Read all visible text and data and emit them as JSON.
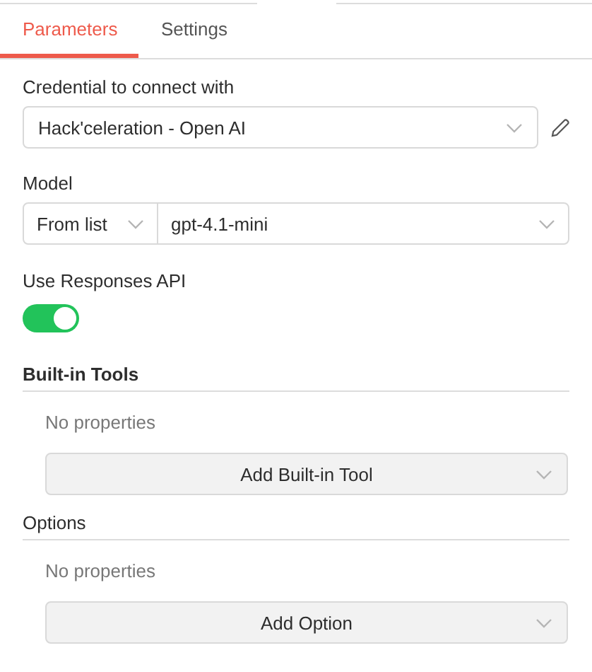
{
  "tabs": [
    {
      "label": "Parameters",
      "selected": true
    },
    {
      "label": "Settings",
      "selected": false
    }
  ],
  "credential": {
    "label": "Credential to connect with",
    "value": "Hack'celeration - Open AI"
  },
  "model": {
    "label": "Model",
    "mode": "From list",
    "value": "gpt-4.1-mini"
  },
  "responses_api": {
    "label": "Use Responses API",
    "on": true
  },
  "collections": [
    {
      "title": "Built-in Tools",
      "empty_text": "No properties",
      "button": "Add Built-in Tool"
    },
    {
      "title": "Options",
      "empty_text": "No properties",
      "button": "Add Option"
    }
  ]
}
